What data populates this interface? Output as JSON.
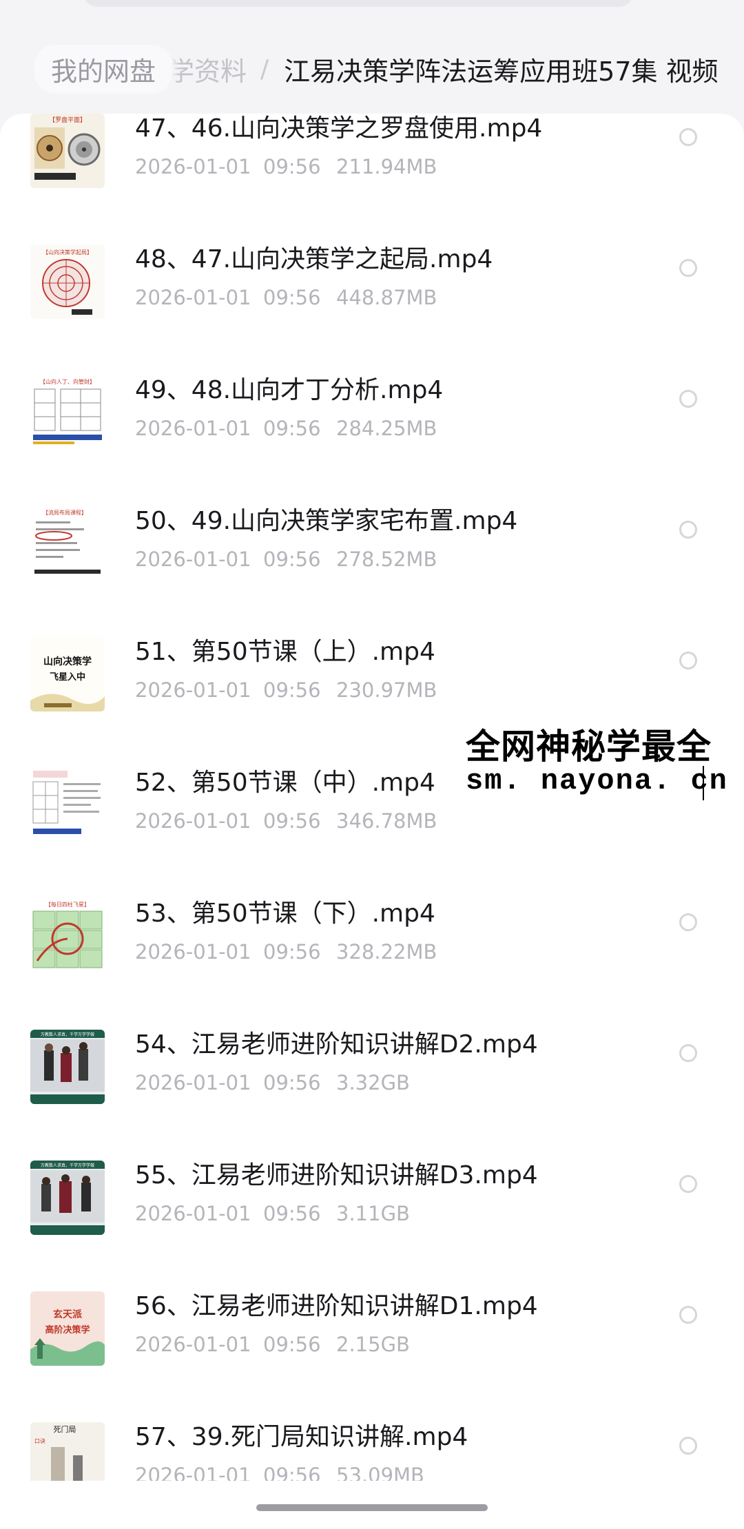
{
  "breadcrumb": {
    "root": "我的网盘",
    "middle": "学资料",
    "separator": "/",
    "current": "江易决策学阵法运筹应用班57集 视频"
  },
  "files": [
    {
      "name": "47、46.山向决策学之罗盘使用.mp4",
      "date": "2026-01-01",
      "time": "09:56",
      "size": "211.94MB",
      "thumb": "compass-image"
    },
    {
      "name": "48、47.山向决策学之起局.mp4",
      "date": "2026-01-01",
      "time": "09:56",
      "size": "448.87MB",
      "thumb": "luopan-chart-image"
    },
    {
      "name": "49、48.山向才丁分析.mp4",
      "date": "2026-01-01",
      "time": "09:56",
      "size": "284.25MB",
      "thumb": "grid-chart-image"
    },
    {
      "name": "50、49.山向决策学家宅布置.mp4",
      "date": "2026-01-01",
      "time": "09:56",
      "size": "278.52MB",
      "thumb": "slide-list-image"
    },
    {
      "name": "51、第50节课（上）.mp4",
      "date": "2026-01-01",
      "time": "09:56",
      "size": "230.97MB",
      "thumb": "title-card-image"
    },
    {
      "name": "52、第50节课（中）.mp4",
      "date": "2026-01-01",
      "time": "09:56",
      "size": "346.78MB",
      "thumb": "table-slide-image"
    },
    {
      "name": "53、第50节课（下）.mp4",
      "date": "2026-01-01",
      "time": "09:56",
      "size": "328.22MB",
      "thumb": "green-grid-image"
    },
    {
      "name": "54、江易老师进阶知识讲解D2.mp4",
      "date": "2026-01-01",
      "time": "09:56",
      "size": "3.32GB",
      "thumb": "classroom-photo"
    },
    {
      "name": "55、江易老师进阶知识讲解D3.mp4",
      "date": "2026-01-01",
      "time": "09:56",
      "size": "3.11GB",
      "thumb": "classroom-photo"
    },
    {
      "name": "56、江易老师进阶知识讲解D1.mp4",
      "date": "2026-01-01",
      "time": "09:56",
      "size": "2.15GB",
      "thumb": "course-cover-image"
    },
    {
      "name": "57、39.死门局知识讲解.mp4",
      "date": "2026-01-01",
      "time": "09:56",
      "size": "53.09MB",
      "thumb": "calligraphy-image"
    }
  ],
  "watermark": {
    "line1": "全网神秘学最全",
    "line2": "sm. nayona. cn"
  },
  "thumb_text": {
    "t1": "【罗盘平面】",
    "t2": "【山向决策学起局】",
    "t3": "【山向人丁、向管财】",
    "t4": "【流局布局课程】",
    "t5a": "山向决策学",
    "t5b": "飞星入中",
    "t7": "【每日四柱飞星】",
    "t8": "万教数人求真，千学万学学做",
    "t10a": "玄天派",
    "t10b": "高阶决策学",
    "t11a": "死门局",
    "t11b": "口诀"
  },
  "colors": {
    "background": "#f4f4f6",
    "sheet": "#ffffff",
    "title": "#1a1a1e",
    "meta": "#b4b4ba",
    "breadcrumb_muted": "#9a9aa2",
    "radio": "#d6d6da"
  }
}
